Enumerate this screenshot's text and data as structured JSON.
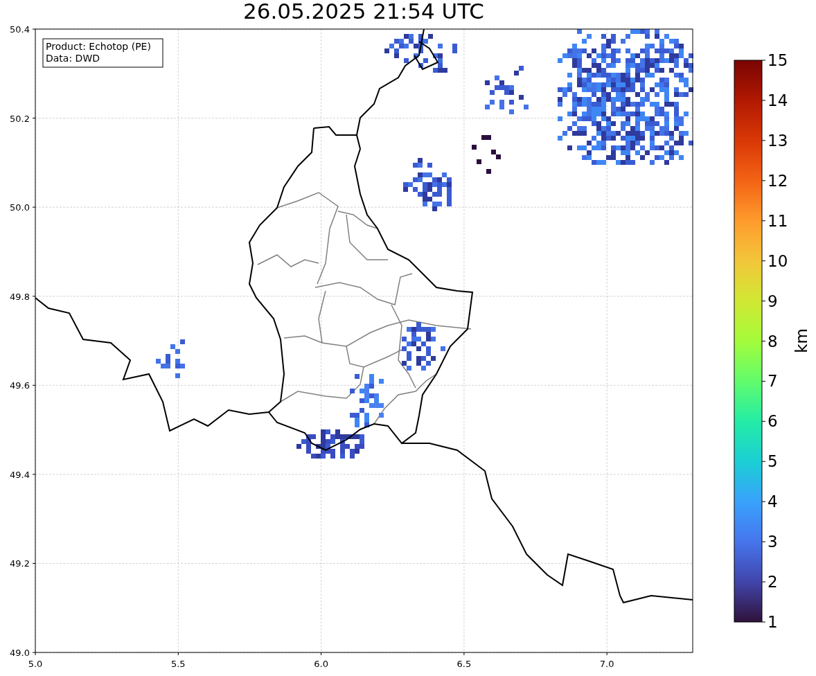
{
  "title": "26.05.2025 21:54 UTC",
  "info_box": [
    "Product: Echotop (PE)",
    "Data: DWD"
  ],
  "x_ticks": [
    "5.0",
    "5.5",
    "6.0",
    "6.5",
    "7.0"
  ],
  "y_ticks": [
    "50.4",
    "50.2",
    "50.0",
    "49.8",
    "49.6",
    "49.4",
    "49.2",
    "49.0"
  ],
  "colorbar": {
    "ticks": [
      "15",
      "14",
      "13",
      "12",
      "11",
      "10",
      "9",
      "8",
      "7",
      "6",
      "5",
      "4",
      "3",
      "2",
      "1"
    ],
    "label": "km"
  }
}
